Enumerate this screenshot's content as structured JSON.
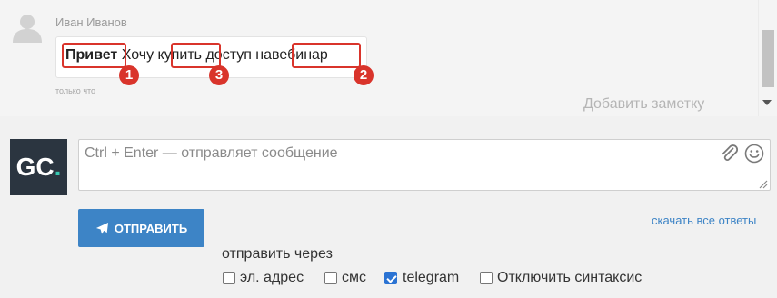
{
  "chat": {
    "author": "Иван Иванов",
    "message": {
      "word1": "Привет",
      "word2": "Хочу",
      "word3": "купить",
      "word4": "доступ на",
      "word5": "вебинар"
    },
    "badges": [
      "1",
      "2",
      "3"
    ],
    "time": "только что",
    "add_note": "Добавить заметку"
  },
  "composer": {
    "logo_main": "GC",
    "logo_accent": ".",
    "placeholder": "Ctrl + Enter — отправляет сообщение",
    "send_label": "ОТПРАВИТЬ",
    "download_link": "скачать все ответы",
    "send_via_label": "отправить через",
    "options": [
      {
        "label": "эл. адрес",
        "checked": false
      },
      {
        "label": "смс",
        "checked": false
      },
      {
        "label": "telegram",
        "checked": true
      },
      {
        "label": "Отключить синтаксис",
        "checked": false
      }
    ]
  },
  "colors": {
    "accent": "#3d84c6",
    "highlight": "#d9342b",
    "logo_bg": "#2b3540",
    "logo_accent": "#38c9b2"
  }
}
